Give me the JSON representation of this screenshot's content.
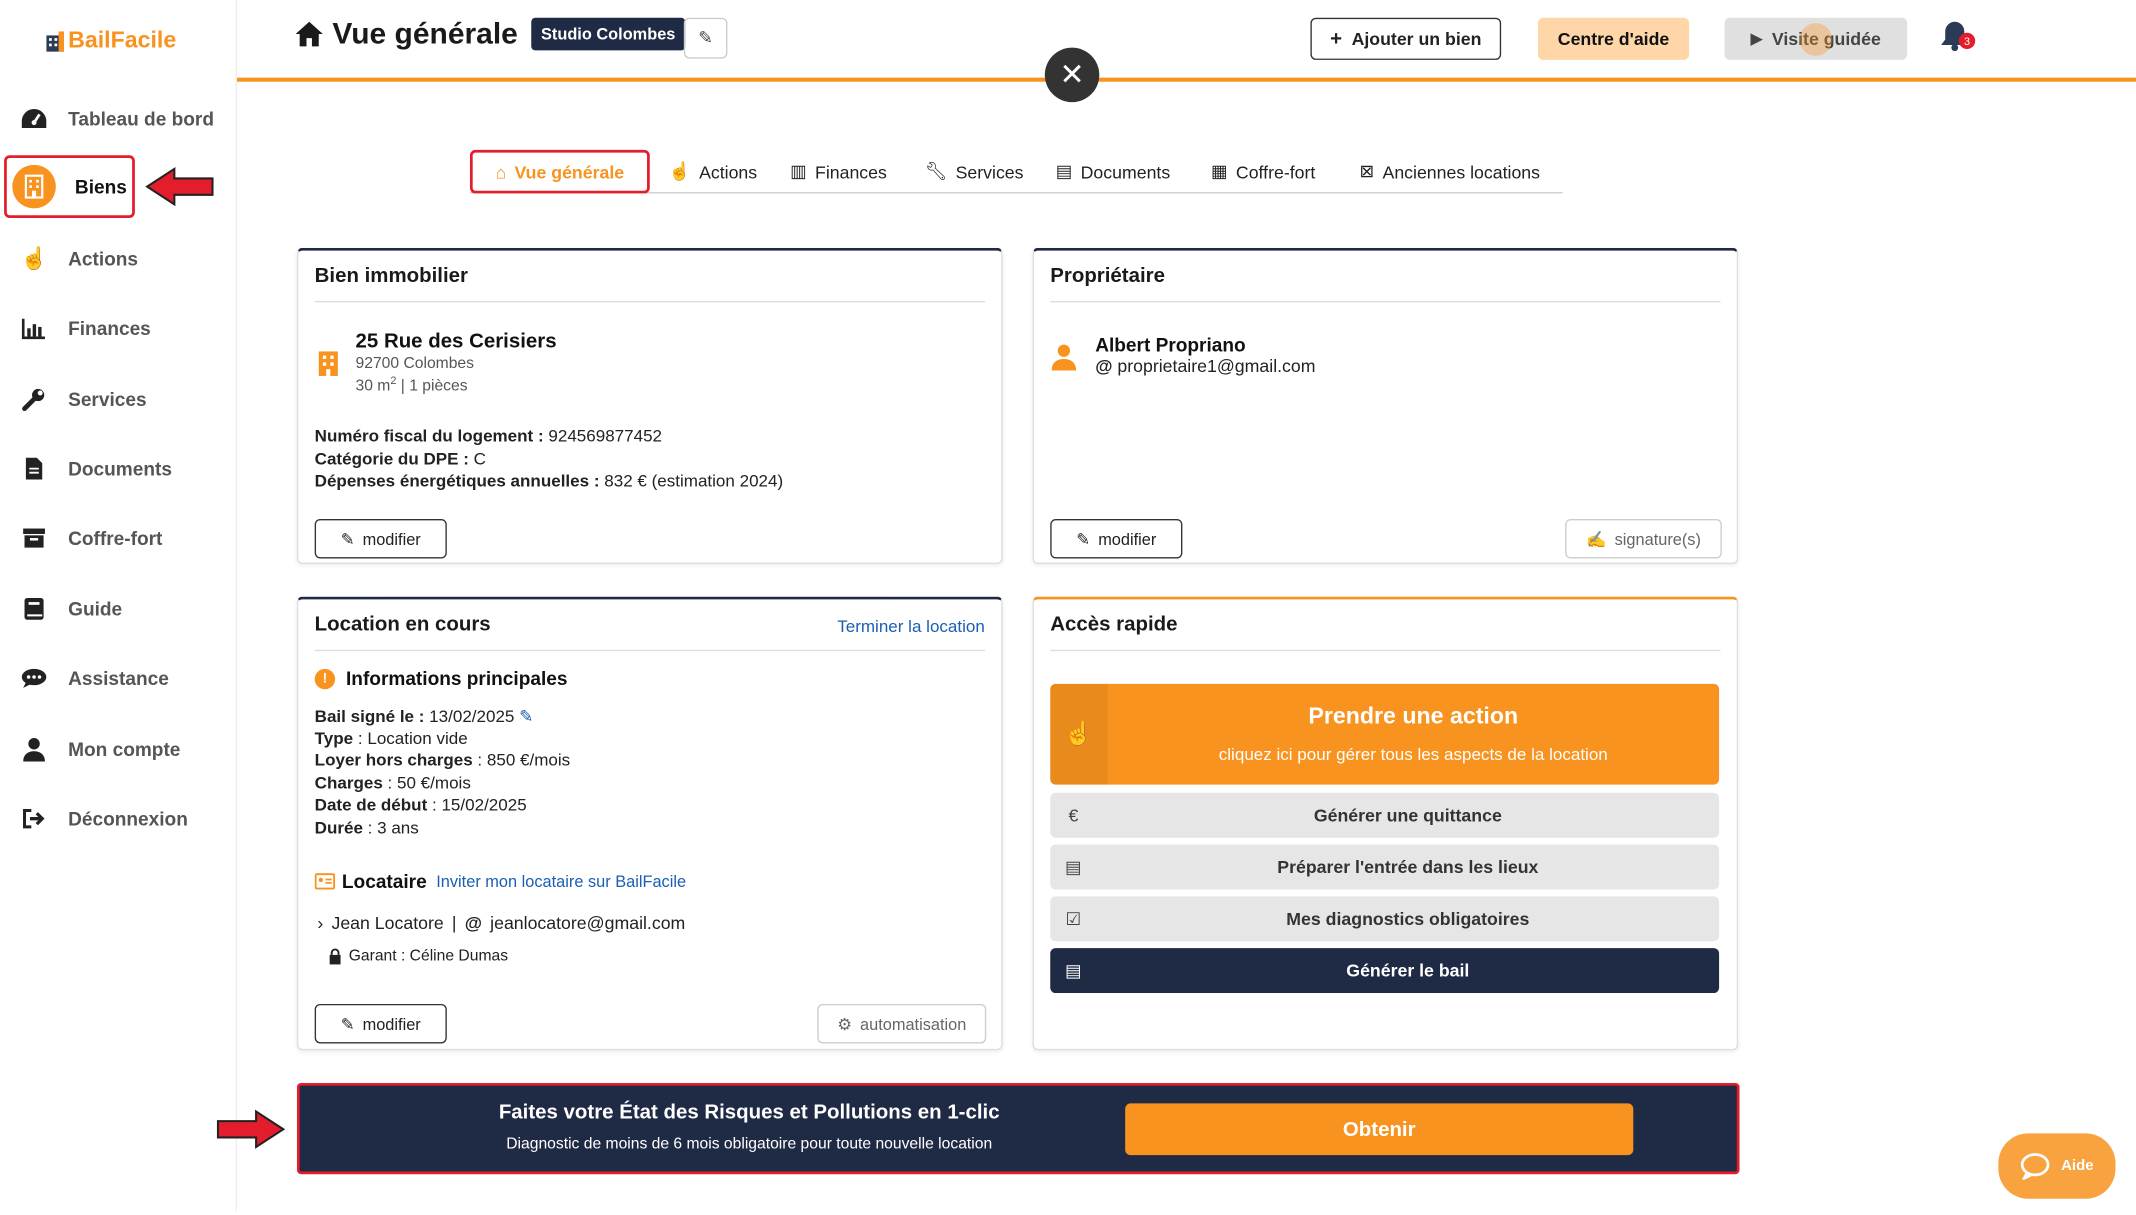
{
  "brand": {
    "name": "BailFacile"
  },
  "sidebar": {
    "items": [
      {
        "label": "Tableau de bord",
        "icon": "dashboard-icon"
      },
      {
        "label": "Biens",
        "icon": "building-icon"
      },
      {
        "label": "Actions",
        "icon": "pointer-hand-icon"
      },
      {
        "label": "Finances",
        "icon": "bar-chart-icon"
      },
      {
        "label": "Services",
        "icon": "wrench-icon"
      },
      {
        "label": "Documents",
        "icon": "document-icon"
      },
      {
        "label": "Coffre-fort",
        "icon": "archive-icon"
      },
      {
        "label": "Guide",
        "icon": "book-icon"
      },
      {
        "label": "Assistance",
        "icon": "chat-icon"
      },
      {
        "label": "Mon compte",
        "icon": "user-icon"
      },
      {
        "label": "Déconnexion",
        "icon": "logout-icon"
      }
    ]
  },
  "header": {
    "title": "Vue générale",
    "property_badge": "Studio Colombes",
    "add_property": "Ajouter un bien",
    "help_center": "Centre d'aide",
    "guided_tour": "Visite guidée",
    "notifications_count": "3"
  },
  "tabs": [
    {
      "label": "Vue générale",
      "icon": "home-icon"
    },
    {
      "label": "Actions",
      "icon": "pointer-hand-icon"
    },
    {
      "label": "Finances",
      "icon": "bar-chart-icon"
    },
    {
      "label": "Services",
      "icon": "wrench-icon"
    },
    {
      "label": "Documents",
      "icon": "document-icon"
    },
    {
      "label": "Coffre-fort",
      "icon": "archive-icon"
    },
    {
      "label": "Anciennes locations",
      "icon": "calendar-x-icon"
    }
  ],
  "property": {
    "title": "Bien immobilier",
    "address": "25 Rue des Cerisiers",
    "city": "92700 Colombes",
    "surface": "30 m",
    "surface_sup": "2",
    "rooms": " | 1 pièces",
    "fiscal_label": "Numéro fiscal du logement :",
    "fiscal_value": " 924569877452",
    "dpe_label": "Catégorie du DPE :",
    "dpe_value": " C",
    "energy_label": "Dépenses énergétiques annuelles :",
    "energy_value": " 832 € (estimation 2024)",
    "edit": "modifier"
  },
  "owner": {
    "title": "Propriétaire",
    "name": "Albert Propriano",
    "email": "proprietaire1@gmail.com",
    "edit": "modifier",
    "signatures": "signature(s)"
  },
  "lease": {
    "title": "Location en cours",
    "end_link": "Terminer la location",
    "info_title": "Informations principales",
    "signed_label": "Bail signé le :",
    "signed_value": " 13/02/2025",
    "type_label": "Type",
    "type_value": " : Location vide",
    "rent_label": "Loyer hors charges",
    "rent_value": " : 850 €/mois",
    "charges_label": "Charges",
    "charges_value": " : 50 €/mois",
    "start_label": "Date de début",
    "start_value": " : 15/02/2025",
    "duration_label": "Durée",
    "duration_value": " : 3 ans",
    "tenant_title": "Locataire",
    "invite_link": "Inviter mon locataire sur BailFacile",
    "tenant_name": "Jean Locatore",
    "tenant_email": "jeanlocatore@gmail.com",
    "guarantor": "Garant : Céline Dumas",
    "edit": "modifier",
    "automation": "automatisation"
  },
  "quick_access": {
    "title": "Accès rapide",
    "main_title": "Prendre une action",
    "main_sub": "cliquez ici pour gérer tous les aspects de la location",
    "receipt": "Générer une quittance",
    "entry": "Préparer l'entrée dans les lieux",
    "diagnostics": "Mes diagnostics obligatoires",
    "lease": "Générer le bail"
  },
  "banner": {
    "title": "Faites votre État des Risques et Pollutions en 1-clic",
    "subtitle": "Diagnostic de moins de 6 mois obligatoire pour toute nouvelle location",
    "cta": "Obtenir"
  },
  "help_widget": {
    "label": "Aide"
  },
  "colors": {
    "accent": "#f7931e",
    "navy": "#1f2a44",
    "highlight": "#e31d2b",
    "link": "#1a5fb4"
  }
}
